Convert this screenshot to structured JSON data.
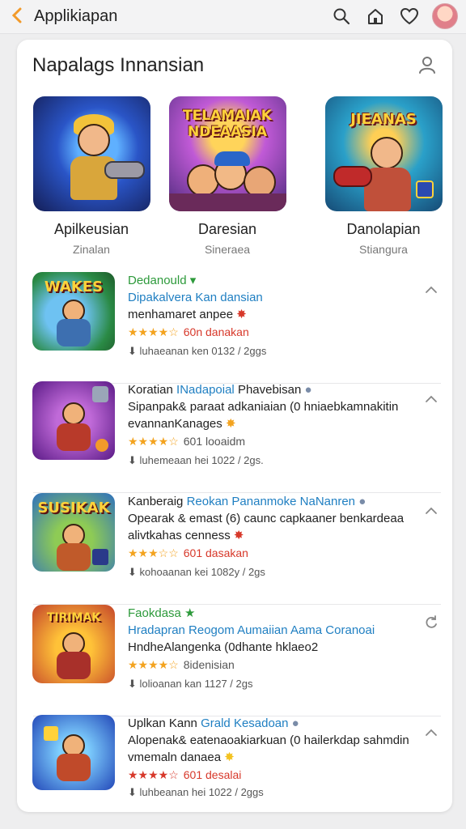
{
  "header": {
    "title": "Applikiapan",
    "icons": [
      "chevron-left-icon",
      "search-icon",
      "home-icon",
      "heart-icon",
      "avatar"
    ]
  },
  "section": {
    "title": "Napalags Innansian",
    "featured": [
      {
        "name": "Apilkeusian",
        "sub": "Zinalan",
        "banner": ""
      },
      {
        "name": "Daresian",
        "sub": "Sineraea",
        "banner": "TELAMAIAK NDEAASIA"
      },
      {
        "name": "Danolapian",
        "sub": "Stiangura",
        "banner": "JIEANAS"
      }
    ]
  },
  "apps": [
    {
      "line1": "Dedanould",
      "line1_color": "#2d9a3b",
      "line2": "Dipakalvera Kan dansian",
      "line3": "menhamaret anpee",
      "stars": "★★★★☆",
      "rating_label": "60n danakan",
      "meta": "luhaeanan ken 0132 / 2ggs",
      "icon_text": "WAKES"
    },
    {
      "line1": "Koratian",
      "line1_extra": "INadapoial",
      "line1_rest": "Phavebisan",
      "line1_color": "#222222",
      "line2": "Sipanpak& paraat adkaniaian (0 hniaebkamnakitin",
      "line3": "evannanKanages",
      "stars": "★★★★☆",
      "rating_label": "601 looaidm",
      "meta": "luhemeaan hei 1022 / 2gs.",
      "icon_text": ""
    },
    {
      "line1": "Kanberaig",
      "line1_extra": "Reokan Pananmoke NaNanren",
      "line1_color": "#222222",
      "line2": "Opearak & emast (6) caunc capkaaner benkardeaa",
      "line3": "alivtkahas cenness",
      "stars": "★★★☆☆",
      "rating_label": "601 dasakan",
      "meta": "kohoaanan kei 1082y / 2gs",
      "icon_text": "SUSIKAK"
    },
    {
      "line1": "Faokdasa",
      "line1_color": "#2d9a3b",
      "line2": "Hradapran Reogom Aumaiian Aama Coranoai",
      "line3": "HndheAlangenka (0dhante hklaeo2",
      "stars": "★★★★☆",
      "rating_label": "8idenisian",
      "meta": "lolioanan kan 1127 / 2gs",
      "icon_text": "TIRIMAK"
    },
    {
      "line1": "Uplkan Kann",
      "line1_extra": "Grald",
      "line1_rest": "Kesadoan",
      "line1_color": "#222222",
      "line2": "Alopenak& eatenaoakiarkuan (0 hailerkdap sahmdin",
      "line3": "vmemaln danaea",
      "stars": "★★★★☆",
      "rating_label": "601 desalai",
      "meta": "luhbeanan hei 1022 / 2ggs",
      "icon_text": ""
    }
  ],
  "colors": {
    "accent": "#f29a2a",
    "link": "#1f7fc2",
    "green": "#2d9a3b",
    "rating_red": "#d7382a",
    "star": "#f3a31f"
  }
}
